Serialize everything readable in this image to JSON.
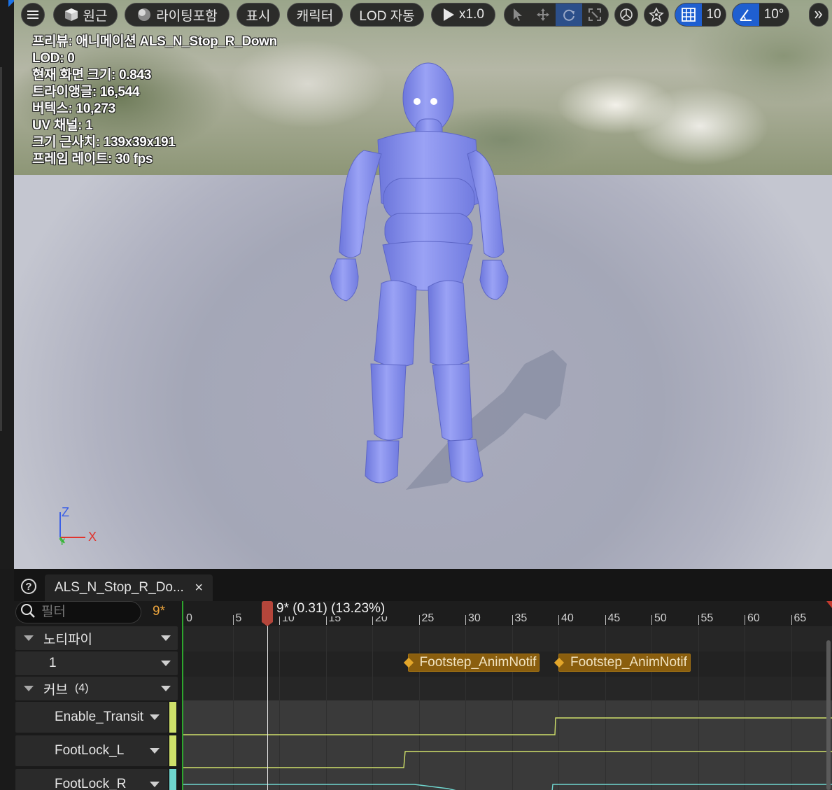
{
  "toolbar": {
    "menu_icon": "hamburger-menu-icon",
    "perspective_label": "원근",
    "lighting_label": "라이팅포함",
    "show_label": "표시",
    "character_label": "캐릭터",
    "lod_label": "LOD 자동",
    "play_speed_label": "x1.0",
    "grid_snap_value": "10",
    "rotation_snap_value": "10°"
  },
  "stats": {
    "preview": "프리뷰: 애니메이션 ALS_N_Stop_R_Down",
    "lod": "LOD: 0",
    "screen_size": "현재 화면 크기: 0.843",
    "triangles": "트라이앵글: 16,544",
    "vertices": "버텍스: 10,273",
    "uv_channels": "UV 채널: 1",
    "approx_size": "크기 근사치: 139x39x191",
    "frame_rate": "프레임 레이트: 30 fps"
  },
  "gizmo": {
    "z": "Z",
    "x": "X",
    "y": "Y"
  },
  "panel": {
    "help_icon": "?",
    "tab_title": "ALS_N_Stop_R_Do...",
    "tab_close": "×",
    "filter_placeholder": "필터",
    "frame_indicator": "9*",
    "notify_section": "노티파이",
    "notify_track": "1",
    "curves_section": "커브",
    "curves_count": "(4)",
    "curves": [
      {
        "name": "Enable_Transit",
        "color": "#cfe06a"
      },
      {
        "name": "FootLock_L",
        "color": "#cfe06a"
      },
      {
        "name": "FootLock_R",
        "color": "#6fd6cf"
      }
    ],
    "playhead_label": "9* (0.31) (13.23%)",
    "playhead_frame": 9,
    "ruler_labels": [
      "0",
      "5",
      "10",
      "15",
      "20",
      "25",
      "30",
      "35",
      "40",
      "45",
      "50",
      "55",
      "60",
      "65"
    ],
    "notifies": [
      {
        "label": "Footstep_AnimNotif",
        "frame": 23.5
      },
      {
        "label": "Footstep_AnimNotif",
        "frame": 39.7
      }
    ]
  }
}
